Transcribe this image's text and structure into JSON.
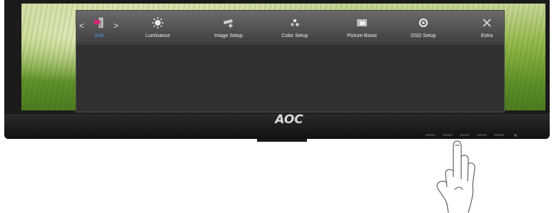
{
  "monitor": {
    "brand": "AOC"
  },
  "osd": {
    "nav_left": "<",
    "nav_right": ">",
    "items": [
      {
        "label": "Exit",
        "icon": "exit-door-icon",
        "active": true
      },
      {
        "label": "Luminance",
        "icon": "brightness-icon"
      },
      {
        "label": "Image Setup",
        "icon": "image-setup-icon"
      },
      {
        "label": "Color Setup",
        "icon": "color-setup-icon"
      },
      {
        "label": "Picture Boost",
        "icon": "picture-boost-icon"
      },
      {
        "label": "OSD Setup",
        "icon": "osd-setup-icon"
      },
      {
        "label": "Extra",
        "icon": "extra-icon"
      }
    ]
  },
  "colors": {
    "active_label": "#4aa3ff",
    "osd_bg": "#333333"
  }
}
